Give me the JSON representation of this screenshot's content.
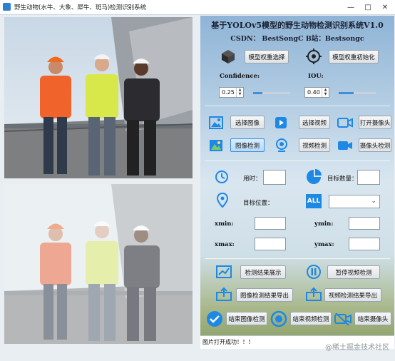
{
  "window": {
    "title": "野生动物(水牛、大象、犀牛、斑马)检测识别系统"
  },
  "header": {
    "title": "基于YOLOv5模型的野生动物检测识别系统V1.0",
    "subtitle": "CSDN：  BestSongC    B站：Bestsongc"
  },
  "model": {
    "select_label": "模型权重选择",
    "init_label": "模型权重初始化"
  },
  "params": {
    "confidence_label": "Confidence:",
    "confidence_value": "0.25",
    "confidence_level": 0.25,
    "iou_label": "IOU:",
    "iou_value": "0.40",
    "iou_level": 0.4
  },
  "actions": {
    "select_image": "选择图像",
    "select_video": "选择视频",
    "open_camera": "打开摄像头",
    "image_detect": "图像检测",
    "video_detect": "视频检测",
    "camera_detect": "摄像头检测"
  },
  "results": {
    "time_label": "用时：",
    "count_label": "目标数量：",
    "position_label": "目标位置：",
    "xmin_label": "xmin:",
    "ymin_label": "ymin:",
    "xmax_label": "xmax:",
    "ymax_label": "ymax:",
    "all_badge": "ALL"
  },
  "controls": {
    "show_results": "检测结果展示",
    "pause_video": "暂停视频检测",
    "export_image": "图像检测结果导出",
    "export_video": "视频检测结果导出",
    "end_image": "结束图像检测",
    "end_video": "结束视频检测",
    "end_camera": "结束摄像头"
  },
  "status": {
    "message": "图片打开成功！！！"
  },
  "watermark": "@稀土掘金技术社区",
  "colors": {
    "accent": "#3d8fd8",
    "status_blue": "#1e88e5"
  }
}
